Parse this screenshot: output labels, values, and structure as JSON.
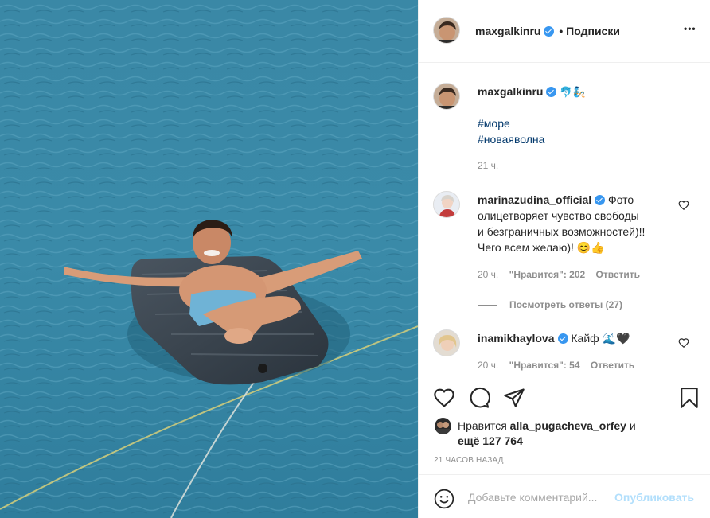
{
  "post": {
    "username": "maxgalkinru",
    "separator": "•",
    "follow_status": "Подписки",
    "more_label": "•••"
  },
  "caption": {
    "username": "maxgalkinru",
    "emoji": "🐬🧞",
    "hashtags": [
      "#море",
      "#новаяволна"
    ],
    "time": "21 ч."
  },
  "comments": [
    {
      "username": "marinazudina_official",
      "lines": [
        "Фото",
        "олицетворяет чувство свободы",
        "и безграничных возможностей)!!",
        "Чего всем желаю)! 😊👍"
      ],
      "time": "20 ч.",
      "likes": "\"Нравится\": 202",
      "reply": "Ответить"
    },
    {
      "username": "inamikhaylova",
      "text": "Кайф 🌊🖤",
      "time": "20 ч.",
      "likes": "\"Нравится\": 54",
      "reply": "Ответить"
    }
  ],
  "view_replies": "Посмотреть ответы (27)",
  "likes_line": {
    "prefix": "Нравится",
    "liker": "alla_pugacheva_orfey",
    "conj": "и",
    "rest": "ещё 127 764"
  },
  "timestamp": "21 ЧАСОВ НАЗАД",
  "add_comment": {
    "placeholder": "Добавьте комментарий...",
    "publish": "Опубликовать"
  },
  "icons": {
    "like": "heart-icon",
    "comment": "comment-icon",
    "share": "share-icon",
    "save": "bookmark-icon",
    "emoji": "emoji-icon",
    "more": "more-icon"
  },
  "colors": {
    "verified": "#3897f0",
    "hashtag": "#00376b",
    "publish_disabled": "#b2dffc",
    "sea": "#3b8aa8"
  }
}
